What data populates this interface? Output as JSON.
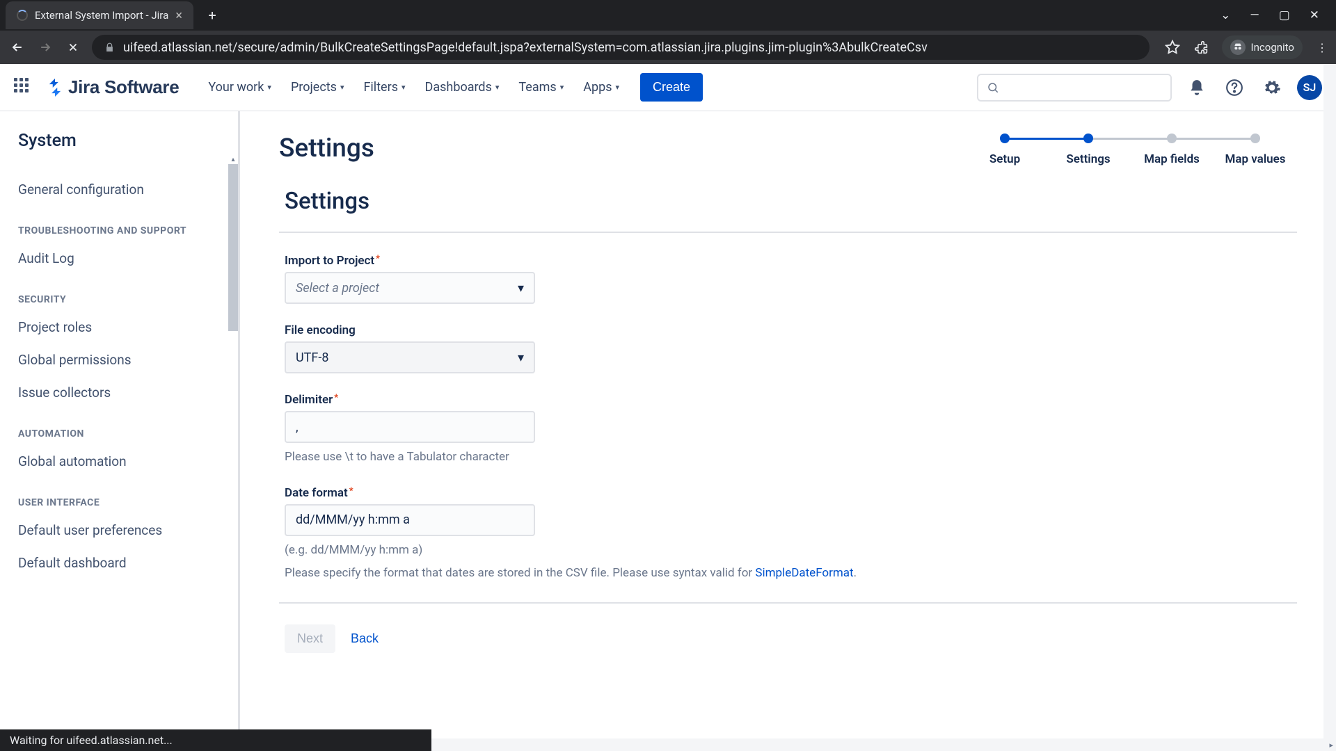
{
  "browser": {
    "tab_title": "External System Import - Jira",
    "url": "uifeed.atlassian.net/secure/admin/BulkCreateSettingsPage!default.jspa?externalSystem=com.atlassian.jira.plugins.jim-plugin%3AbulkCreateCsv",
    "incognito_label": "Incognito",
    "status": "Waiting for uifeed.atlassian.net..."
  },
  "header": {
    "logo_text": "Jira Software",
    "nav": [
      "Your work",
      "Projects",
      "Filters",
      "Dashboards",
      "Teams",
      "Apps"
    ],
    "create_label": "Create",
    "avatar_initials": "SJ"
  },
  "sidebar": {
    "title": "System",
    "groups": [
      {
        "heading": null,
        "items": [
          "General configuration"
        ]
      },
      {
        "heading": "TROUBLESHOOTING AND SUPPORT",
        "items": [
          "Audit Log"
        ]
      },
      {
        "heading": "SECURITY",
        "items": [
          "Project roles",
          "Global permissions",
          "Issue collectors"
        ]
      },
      {
        "heading": "AUTOMATION",
        "items": [
          "Global automation"
        ]
      },
      {
        "heading": "USER INTERFACE",
        "items": [
          "Default user preferences",
          "Default dashboard"
        ]
      }
    ]
  },
  "stepper": {
    "steps": [
      {
        "label": "Setup",
        "state": "done"
      },
      {
        "label": "Settings",
        "state": "active"
      },
      {
        "label": "Map fields",
        "state": "pending"
      },
      {
        "label": "Map values",
        "state": "pending"
      }
    ]
  },
  "page": {
    "title": "Settings",
    "subtitle": "Settings",
    "fields": {
      "project": {
        "label": "Import to Project",
        "placeholder": "Select a project",
        "required": true
      },
      "encoding": {
        "label": "File encoding",
        "value": "UTF-8",
        "required": false
      },
      "delimiter": {
        "label": "Delimiter",
        "value": ",",
        "required": true,
        "help": "Please use \\t to have a Tabulator character"
      },
      "dateformat": {
        "label": "Date format",
        "value": "dd/MMM/yy h:mm a",
        "required": true,
        "example": "(e.g. dd/MMM/yy h:mm a)",
        "help_pre": "Please specify the format that dates are stored in the CSV file. Please use syntax valid for ",
        "help_link": "SimpleDateFormat",
        "help_post": "."
      }
    },
    "buttons": {
      "next": "Next",
      "back": "Back"
    }
  }
}
